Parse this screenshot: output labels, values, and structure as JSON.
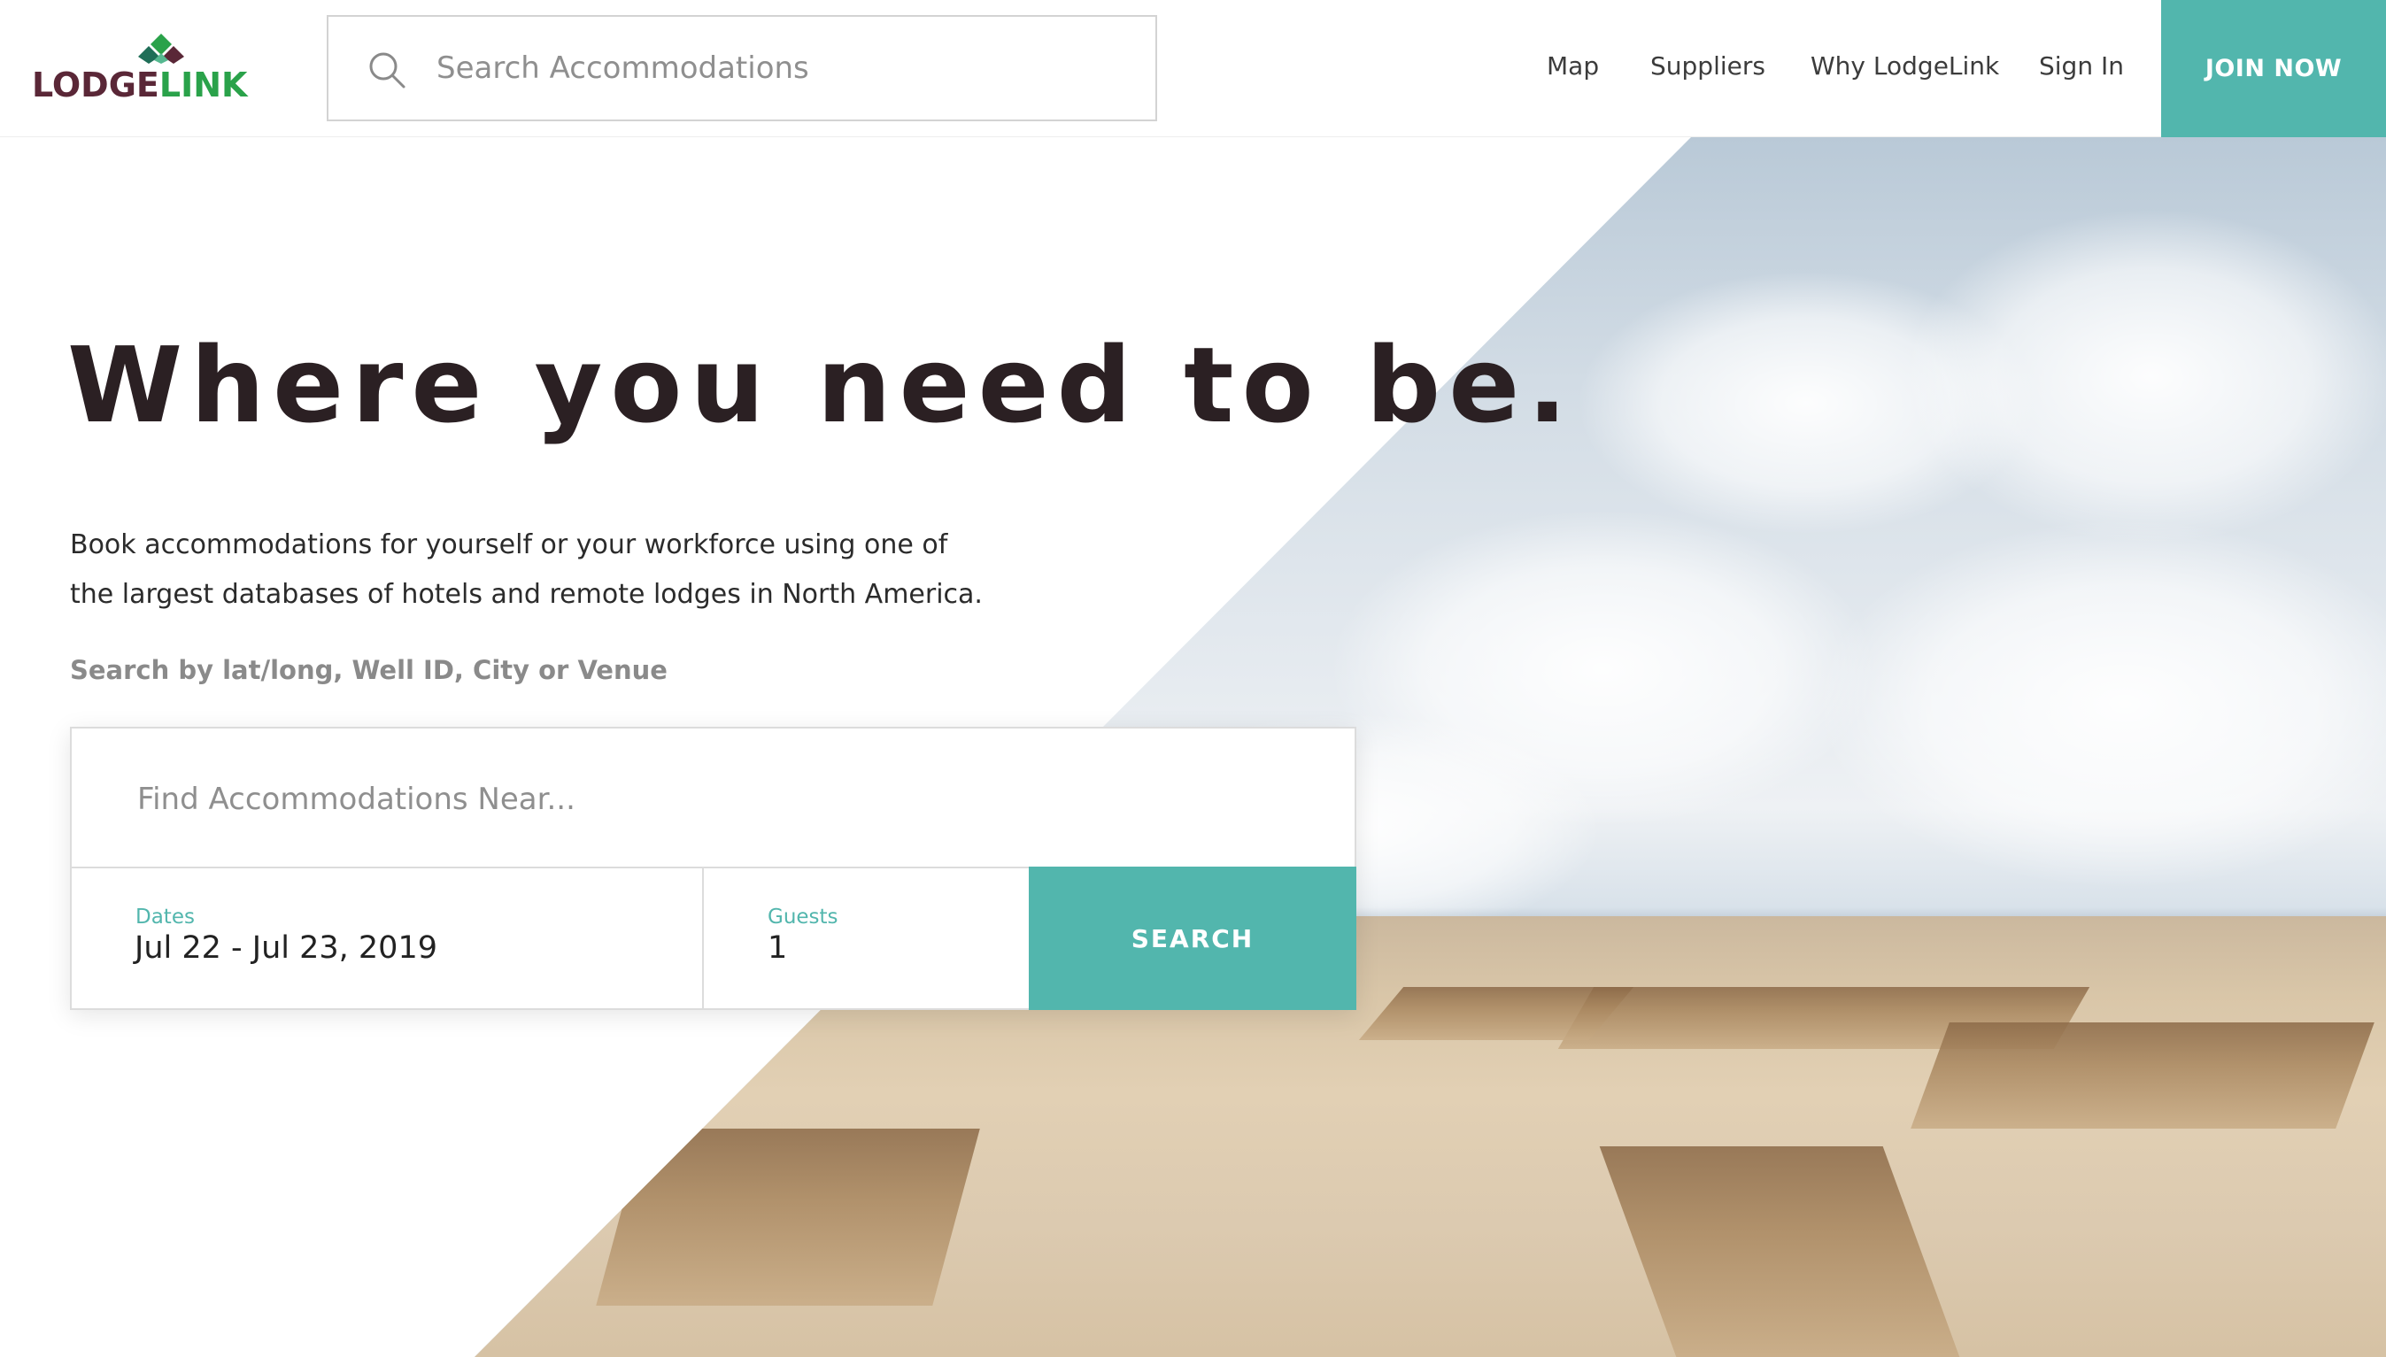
{
  "brand": {
    "logo_part1": "LODGE",
    "logo_part2": "LINK",
    "logo_colors": {
      "lodge": "#5a2737",
      "link": "#2aa24a",
      "mark_top": "#2aa24a",
      "mark_left": "#1f6e57",
      "mark_right": "#5a2737"
    }
  },
  "header": {
    "search_placeholder": "Search Accommodations",
    "nav": {
      "map": "Map",
      "suppliers": "Suppliers",
      "why": "Why LodgeLink",
      "sign_in": "Sign In"
    },
    "join_label": "JOIN NOW"
  },
  "hero": {
    "title": "Where you need to be.",
    "description_line1": "Book accommodations for yourself or your workforce using one of",
    "description_line2": "the largest databases of hotels and remote lodges in North America.",
    "hint": "Search by lat/long, Well ID, City or Venue"
  },
  "search_panel": {
    "near_placeholder": "Find Accommodations Near...",
    "dates_label": "Dates",
    "dates_value": "Jul 22 - Jul 23, 2019",
    "guests_label": "Guests",
    "guests_value": "1",
    "search_label": "SEARCH"
  },
  "colors": {
    "accent": "#52b6ad",
    "heading": "#2b2023",
    "muted": "#8a8a8a"
  },
  "icons": {
    "search": "search-icon",
    "logo_mark": "logo-diamond-icon"
  }
}
